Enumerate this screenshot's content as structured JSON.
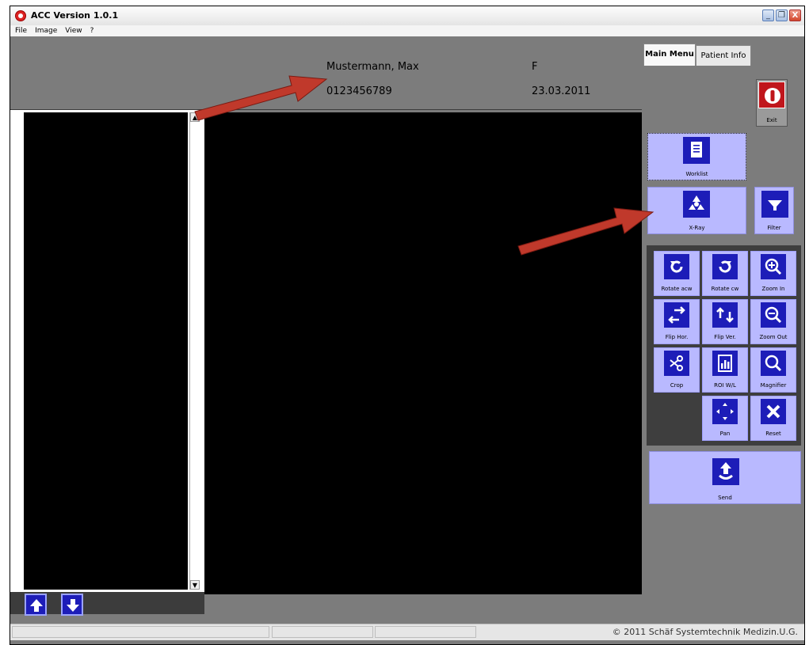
{
  "window": {
    "title": "ACC Version 1.0.1",
    "buttons": [
      "_",
      "❐",
      "X"
    ]
  },
  "menu": [
    "File",
    "Image",
    "View",
    "?"
  ],
  "patient": {
    "name": "Mustermann, Max",
    "sex": "F",
    "id": "0123456789",
    "date": "23.03.2011"
  },
  "tabs": [
    "Main Menu",
    "Patient Info"
  ],
  "buttons": {
    "exit": "Exit",
    "worklist": "Worklist",
    "xray": "X-Ray",
    "filter": "Filter",
    "send": "Send"
  },
  "tools": [
    {
      "label": "Rotate acw",
      "icon": "rotate-acw-icon"
    },
    {
      "label": "Rotate cw",
      "icon": "rotate-cw-icon"
    },
    {
      "label": "Zoom In",
      "icon": "zoom-in-icon"
    },
    {
      "label": "Flip Hor.",
      "icon": "flip-horizontal-icon"
    },
    {
      "label": "Flip Ver.",
      "icon": "flip-vertical-icon"
    },
    {
      "label": "Zoom Out",
      "icon": "zoom-out-icon"
    },
    {
      "label": "Crop",
      "icon": "scissors-icon"
    },
    {
      "label": "ROI W/L",
      "icon": "roi-icon"
    },
    {
      "label": "Magnifier",
      "icon": "magnifier-icon"
    },
    {
      "label": "Pan",
      "icon": "pan-icon"
    },
    {
      "label": "Reset",
      "icon": "reset-x-icon"
    }
  ],
  "status": {
    "copyright": "© 2011 Schäf Systemtechnik Medizin.U.G."
  },
  "colors": {
    "icon_bg": "#1d1db8",
    "button_bg": "#b9b9ff",
    "panel": "#7c7c7c",
    "arrow": "#c0392b"
  }
}
